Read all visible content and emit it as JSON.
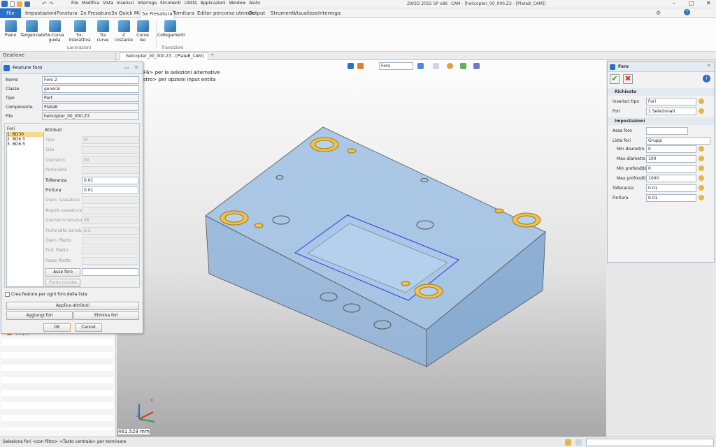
{
  "titlebar": {
    "quick_menu": [
      "File",
      "Modifica",
      "Vista",
      "Inserisci",
      "Interroga",
      "Strumenti",
      "Utilità",
      "Applicazioni",
      "Window",
      "Aiuto"
    ],
    "title": "ZW3D 2015 SP x86",
    "doc": "CAM - [helicopter_00_000.Z3 - [PlateB_CAM]]"
  },
  "menubar": {
    "file": "File",
    "tabs": [
      "Impostazioni",
      "Foratura",
      "2x Fresatura",
      "3x Quick Mill",
      "5x Fresatura",
      "Tornitura",
      "Editor percorso utensile",
      "Output",
      "Strumenti",
      "Visualizza",
      "Interroga"
    ]
  },
  "ribbon": {
    "buttons": [
      "Piano",
      "Tangenziale",
      "5x-Curva guida",
      "5x-Interattiva",
      "Tra curve",
      "Z costante",
      "Curve Iso",
      "Collegamenti"
    ],
    "groups": [
      "Lavorazioni",
      "Transizioni"
    ]
  },
  "leftpane": {
    "title": "Gestione",
    "tree_item": "Output"
  },
  "doctab": "helicopter_00_000.Z3 - [PlateB_CAM]",
  "viewport": {
    "hint1": "F6> per le selezioni alternative",
    "hint2": "stro> per opzioni input entita",
    "filter": "Foro",
    "measure": "461.529 mm",
    "axis_x": "X",
    "axis_z": "Z"
  },
  "dialog": {
    "title": "Feature foro",
    "rows": [
      {
        "label": "Nome",
        "value": "Foro 2"
      },
      {
        "label": "Classe",
        "value": "general"
      },
      {
        "label": "Tipo",
        "value": "Part"
      },
      {
        "label": "Componente",
        "value": "PlateB"
      },
      {
        "label": "File",
        "value": "helicopter_00_000.Z3"
      }
    ],
    "fori_label": "Fori",
    "fori_list": [
      "1. BD30",
      "2. BD6.5",
      "3. BD6.5"
    ],
    "attributi_label": "Attributi",
    "attrs": [
      {
        "label": "Tipo",
        "value": "M"
      },
      {
        "label": "Size",
        "value": ""
      },
      {
        "label": "Diametro",
        "value": "30"
      },
      {
        "label": "Profondità",
        "value": ""
      },
      {
        "label": "Tolleranza",
        "value": "0.01"
      },
      {
        "label": "Finitura",
        "value": "0.01"
      },
      {
        "label": "Diam. svasatura",
        "value": ""
      },
      {
        "label": "Angolo svasatura",
        "value": ""
      },
      {
        "label": "Diametro lamatura",
        "value": "36"
      },
      {
        "label": "Profondità lamatura",
        "value": "6.3"
      },
      {
        "label": "Diam. filetto",
        "value": ""
      },
      {
        "label": "Prof. filetto",
        "value": ""
      },
      {
        "label": "Passo filetto",
        "value": ""
      }
    ],
    "asse_btn": "Asse foro",
    "punto_btn": "Punto iniziale",
    "checkbox": "Crea feature per ogni foro della lista",
    "applica": "Applica attributi",
    "aggiungi": "Aggiungi fori",
    "elimina": "Elimina fori",
    "ok": "OK",
    "cancel": "Cancel"
  },
  "rightpanel": {
    "title": "Foro",
    "richiesto": "Richiesto",
    "rows1": [
      {
        "label": "Inserisci tipo",
        "value": "Fori"
      },
      {
        "label": "Fori",
        "value": "1 Selezionati"
      }
    ],
    "impostazioni": "Impostazioni",
    "asse": "Asse foro",
    "lista_label": "Lista fori",
    "lista_value": "Gruppi",
    "rows2": [
      {
        "label": "Min diametro",
        "value": "0"
      },
      {
        "label": "Max diametro",
        "value": "100"
      },
      {
        "label": "Min profondità",
        "value": "0"
      },
      {
        "label": "Max profondità",
        "value": "1000"
      }
    ],
    "rows3": [
      {
        "label": "Tolleranza",
        "value": "0.01"
      },
      {
        "label": "Finitura",
        "value": "0.01"
      }
    ]
  },
  "statusbar": {
    "text": "Seleziona fori <con filtro> <Tasto centrale> per terminare"
  },
  "colors": {
    "accent": "#2a6fc9",
    "part": "#8fb3d9",
    "hole": "#e8b23a"
  }
}
